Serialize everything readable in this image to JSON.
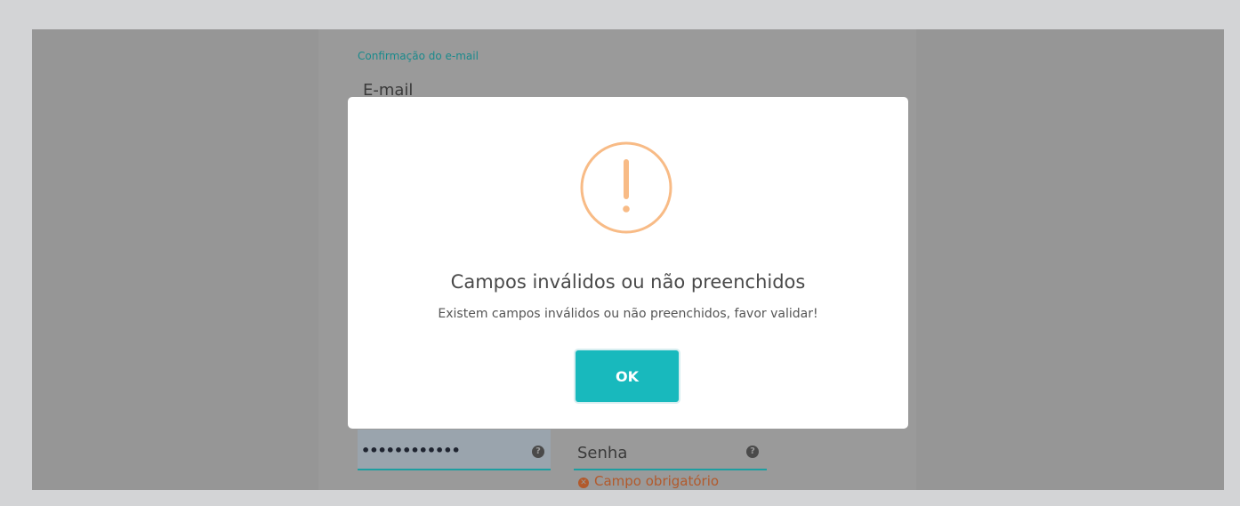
{
  "form": {
    "section_label": "Confirmação do e-mail",
    "email_label": "E-mail",
    "password_value": "••••••••••••",
    "senha_label": "Senha",
    "help_glyph": "?",
    "error_text": "Campo obrigatório"
  },
  "dialog": {
    "icon": "warning-exclamation-icon",
    "icon_color": "#f8bb86",
    "title": "Campos inválidos ou não preenchidos",
    "message": "Existem campos inválidos ou não preenchidos, favor validar!",
    "ok_label": "OK",
    "ok_color": "#18b9bd"
  }
}
